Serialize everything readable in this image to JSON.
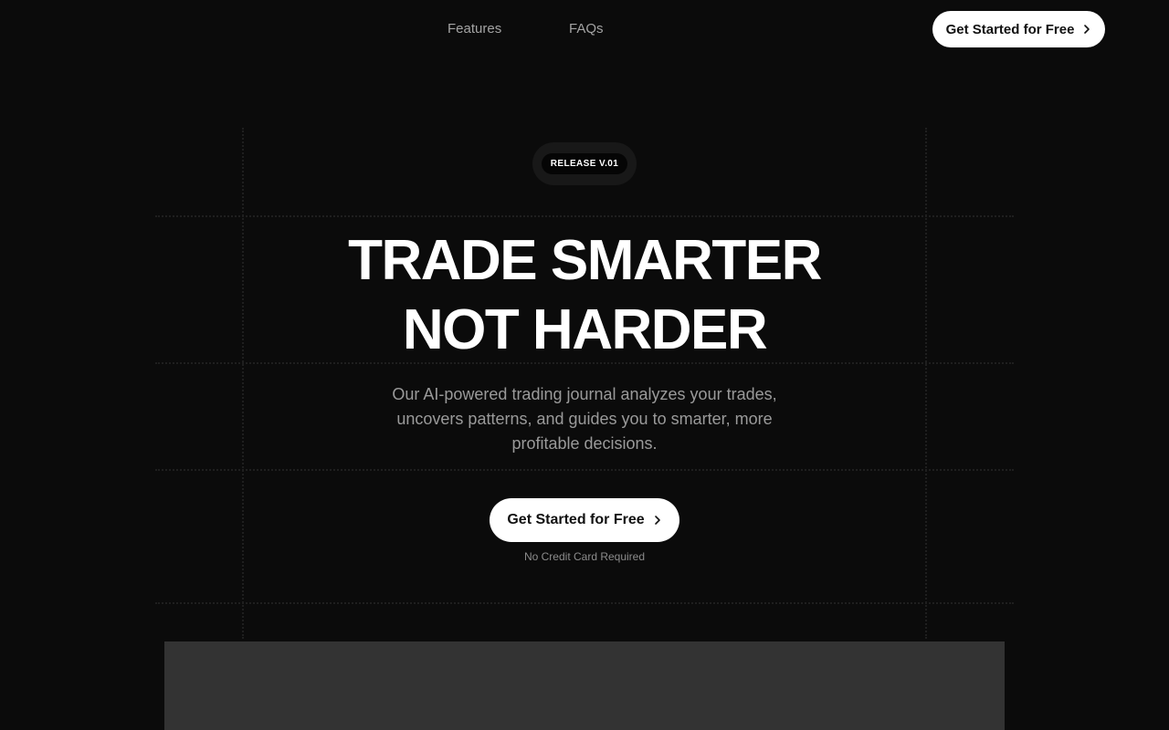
{
  "nav": {
    "links": [
      {
        "label": "Features"
      },
      {
        "label": "FAQs"
      }
    ],
    "cta_label": "Get Started for Free"
  },
  "hero": {
    "badge": "RELEASE V.01",
    "headline_line1": "TRADE SMARTER",
    "headline_line2": "NOT HARDER",
    "subtext": "Our AI-powered trading journal analyzes your trades, uncovers patterns, and guides you to smarter, more profitable decisions.",
    "cta_label": "Get Started for Free",
    "cta_note": "No Credit Card Required"
  },
  "icons": {
    "cta_chevron": "chevron-right-icon"
  },
  "colors": {
    "background": "#0b0b0b",
    "button": "#ffffff",
    "muted_text": "#9a9a9a",
    "preview_panel": "#333333"
  }
}
